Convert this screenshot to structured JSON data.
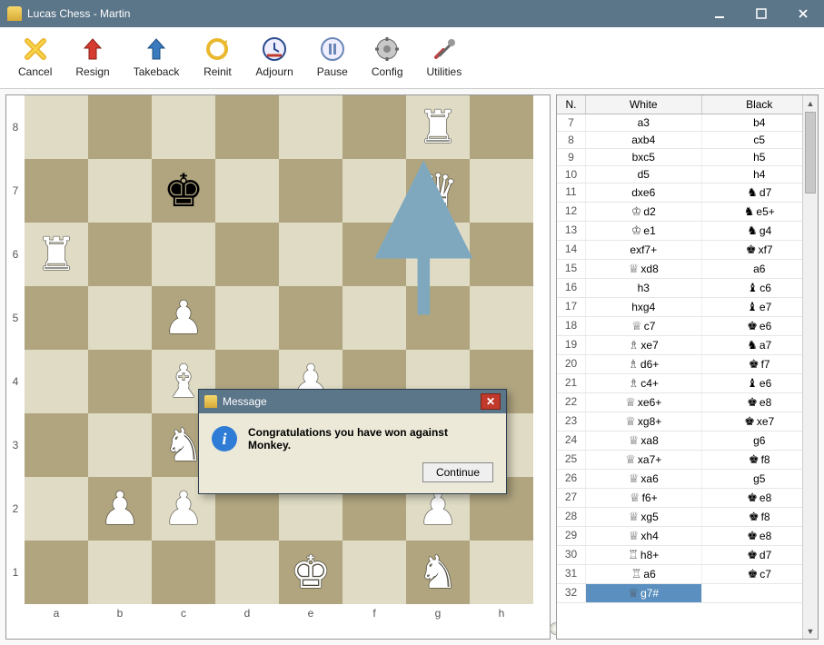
{
  "window": {
    "title": "Lucas Chess - Martin"
  },
  "toolbar": {
    "cancel": {
      "label": "Cancel",
      "icon": "cancel-icon"
    },
    "resign": {
      "label": "Resign",
      "icon": "resign-icon"
    },
    "takeback": {
      "label": "Takeback",
      "icon": "takeback-icon"
    },
    "reinit": {
      "label": "Reinit",
      "icon": "reinit-icon"
    },
    "adjourn": {
      "label": "Adjourn",
      "icon": "adjourn-icon"
    },
    "pause": {
      "label": "Pause",
      "icon": "pause-icon"
    },
    "config": {
      "label": "Config",
      "icon": "config-icon"
    },
    "utilities": {
      "label": "Utilities",
      "icon": "utilities-icon"
    }
  },
  "board": {
    "files": [
      "a",
      "b",
      "c",
      "d",
      "e",
      "f",
      "g",
      "h"
    ],
    "ranks": [
      "8",
      "7",
      "6",
      "5",
      "4",
      "3",
      "2",
      "1"
    ],
    "light_color": "#dfdbc4",
    "dark_color": "#b0a57f",
    "arrow_from": "g5",
    "arrow_to": "g7",
    "pieces": [
      {
        "sq": "g8",
        "glyph": "♜",
        "color": "w"
      },
      {
        "sq": "c7",
        "glyph": "♚",
        "color": "b"
      },
      {
        "sq": "g7",
        "glyph": "♛",
        "color": "w"
      },
      {
        "sq": "a6",
        "glyph": "♜",
        "color": "w"
      },
      {
        "sq": "c5",
        "glyph": "♟",
        "color": "w"
      },
      {
        "sq": "c4",
        "glyph": "♝",
        "color": "w"
      },
      {
        "sq": "e4",
        "glyph": "♟",
        "color": "w"
      },
      {
        "sq": "c3",
        "glyph": "♞",
        "color": "w"
      },
      {
        "sq": "b2",
        "glyph": "♟",
        "color": "w"
      },
      {
        "sq": "c2",
        "glyph": "♟",
        "color": "w"
      },
      {
        "sq": "g2",
        "glyph": "♟",
        "color": "w"
      },
      {
        "sq": "e1",
        "glyph": "♚",
        "color": "w"
      },
      {
        "sq": "g1",
        "glyph": "♞",
        "color": "w"
      }
    ]
  },
  "movelist": {
    "headers": {
      "n": "N.",
      "white": "White",
      "black": "Black"
    },
    "selected": {
      "n": 32,
      "col": "white"
    },
    "rows": [
      {
        "n": 7,
        "white": {
          "t": "a3"
        },
        "black": {
          "t": "b4"
        }
      },
      {
        "n": 8,
        "white": {
          "t": "axb4"
        },
        "black": {
          "t": "c5"
        }
      },
      {
        "n": 9,
        "white": {
          "t": "bxc5"
        },
        "black": {
          "t": "h5"
        }
      },
      {
        "n": 10,
        "white": {
          "t": "d5"
        },
        "black": {
          "t": "h4"
        }
      },
      {
        "n": 11,
        "white": {
          "t": "dxe6"
        },
        "black": {
          "p": "♞",
          "pc": "b",
          "t": "d7"
        }
      },
      {
        "n": 12,
        "white": {
          "p": "♔",
          "pc": "w",
          "t": "d2"
        },
        "black": {
          "p": "♞",
          "pc": "b",
          "t": "e5+"
        }
      },
      {
        "n": 13,
        "white": {
          "p": "♔",
          "pc": "w",
          "t": "e1"
        },
        "black": {
          "p": "♞",
          "pc": "b",
          "t": "g4"
        }
      },
      {
        "n": 14,
        "white": {
          "t": "exf7+"
        },
        "black": {
          "p": "♚",
          "pc": "b",
          "t": "xf7"
        }
      },
      {
        "n": 15,
        "white": {
          "p": "♕",
          "pc": "w",
          "t": "xd8"
        },
        "black": {
          "t": "a6"
        }
      },
      {
        "n": 16,
        "white": {
          "t": "h3"
        },
        "black": {
          "p": "♝",
          "pc": "b",
          "t": "c6"
        }
      },
      {
        "n": 17,
        "white": {
          "t": "hxg4"
        },
        "black": {
          "p": "♝",
          "pc": "b",
          "t": "e7"
        }
      },
      {
        "n": 18,
        "white": {
          "p": "♕",
          "pc": "w",
          "t": "c7"
        },
        "black": {
          "p": "♚",
          "pc": "b",
          "t": "e6"
        }
      },
      {
        "n": 19,
        "white": {
          "p": "♗",
          "pc": "w",
          "t": "xe7"
        },
        "black": {
          "p": "♞",
          "pc": "b",
          "t": "a7"
        }
      },
      {
        "n": 20,
        "white": {
          "p": "♗",
          "pc": "w",
          "t": "d6+"
        },
        "black": {
          "p": "♚",
          "pc": "b",
          "t": "f7"
        }
      },
      {
        "n": 21,
        "white": {
          "p": "♗",
          "pc": "w",
          "t": "c4+"
        },
        "black": {
          "p": "♝",
          "pc": "b",
          "t": "e6"
        }
      },
      {
        "n": 22,
        "white": {
          "p": "♕",
          "pc": "w",
          "t": "xe6+"
        },
        "black": {
          "p": "♚",
          "pc": "b",
          "t": "e8"
        }
      },
      {
        "n": 23,
        "white": {
          "p": "♕",
          "pc": "w",
          "t": "xg8+"
        },
        "black": {
          "p": "♚",
          "pc": "b",
          "t": "xe7"
        }
      },
      {
        "n": 24,
        "white": {
          "p": "♕",
          "pc": "w",
          "t": "xa8"
        },
        "black": {
          "t": "g6"
        }
      },
      {
        "n": 25,
        "white": {
          "p": "♕",
          "pc": "w",
          "t": "xa7+"
        },
        "black": {
          "p": "♚",
          "pc": "b",
          "t": "f8"
        }
      },
      {
        "n": 26,
        "white": {
          "p": "♕",
          "pc": "w",
          "t": "xa6"
        },
        "black": {
          "t": "g5"
        }
      },
      {
        "n": 27,
        "white": {
          "p": "♕",
          "pc": "w",
          "t": "f6+"
        },
        "black": {
          "p": "♚",
          "pc": "b",
          "t": "e8"
        }
      },
      {
        "n": 28,
        "white": {
          "p": "♕",
          "pc": "w",
          "t": "xg5"
        },
        "black": {
          "p": "♚",
          "pc": "b",
          "t": "f8"
        }
      },
      {
        "n": 29,
        "white": {
          "p": "♕",
          "pc": "w",
          "t": "xh4"
        },
        "black": {
          "p": "♚",
          "pc": "b",
          "t": "e8"
        }
      },
      {
        "n": 30,
        "white": {
          "p": "♖",
          "pc": "w",
          "t": "h8+"
        },
        "black": {
          "p": "♚",
          "pc": "b",
          "t": "d7"
        }
      },
      {
        "n": 31,
        "white": {
          "p": "♖",
          "pc": "w",
          "t": "a6"
        },
        "black": {
          "p": "♚",
          "pc": "b",
          "t": "c7"
        }
      },
      {
        "n": 32,
        "white": {
          "p": "♕",
          "pc": "w",
          "t": "g7#"
        },
        "black": {
          "t": ""
        }
      }
    ]
  },
  "dialog": {
    "title": "Message",
    "text": "Congratulations you have won against Monkey.",
    "continue": "Continue"
  }
}
